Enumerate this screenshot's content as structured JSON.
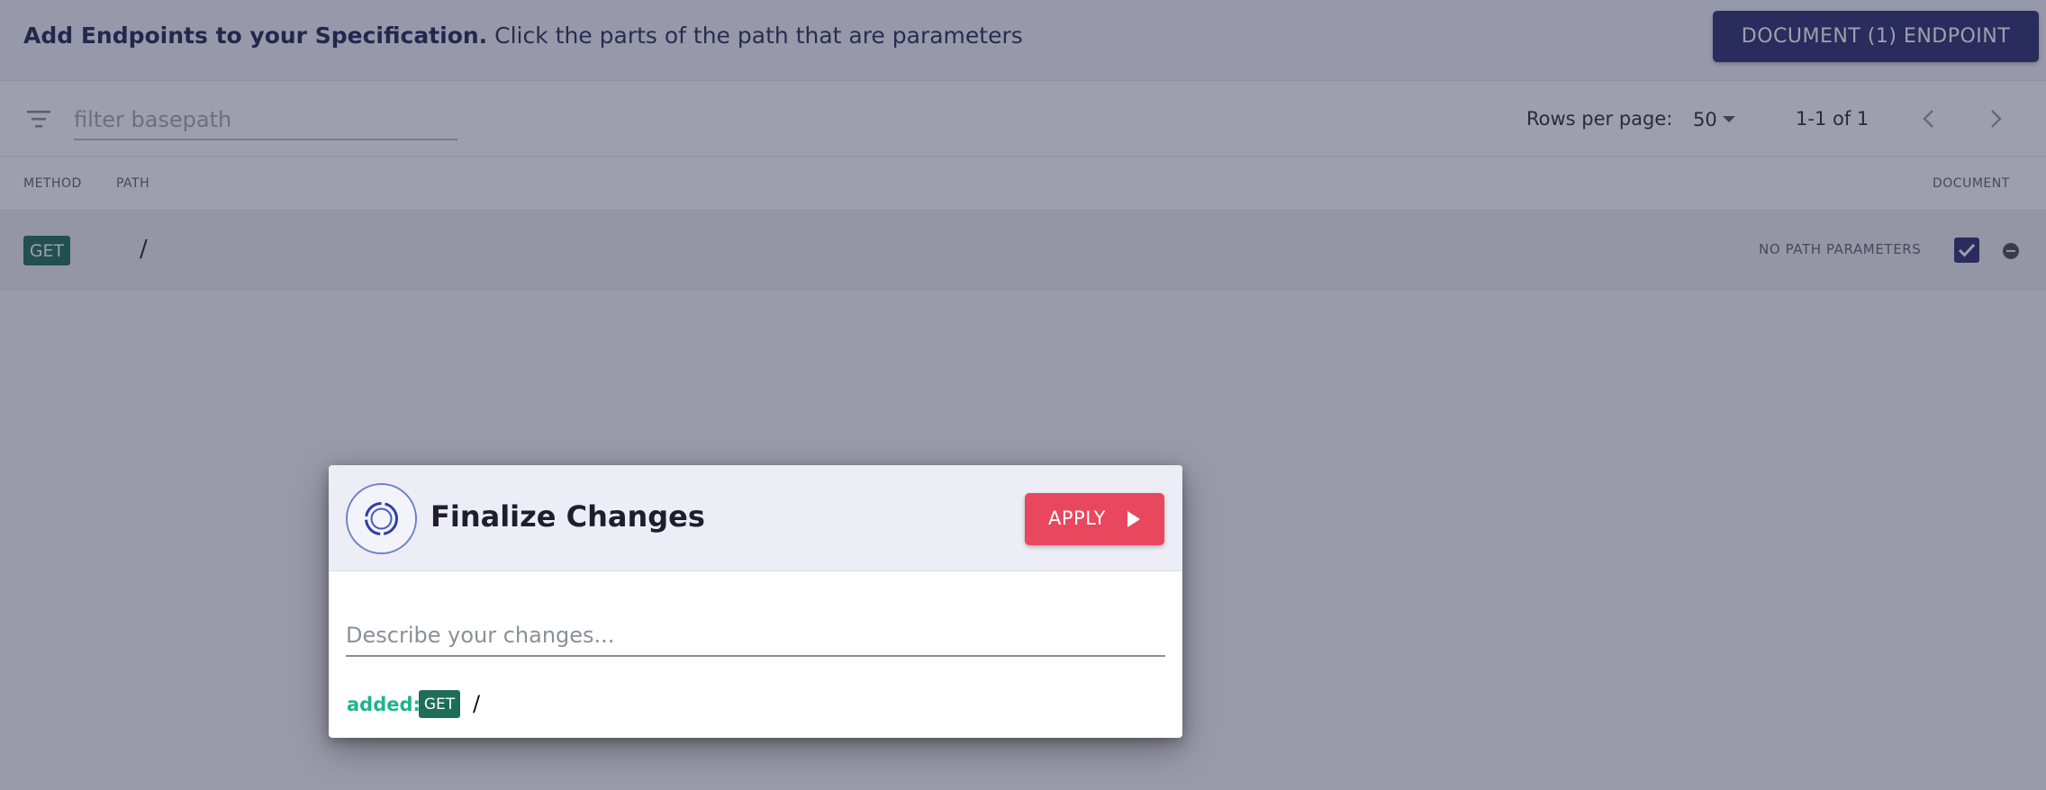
{
  "header": {
    "title_strong": "Add Endpoints to your Specification.",
    "title_rest": " Click the parts of the path that are parameters",
    "document_button_label": "DOCUMENT (1) ENDPOINT"
  },
  "toolbar": {
    "filter_icon": "filter-list-icon",
    "filter_placeholder": "filter basepath",
    "rows_per_page_label": "Rows per page:",
    "rows_per_page_value": "50",
    "page_info": "1-1 of 1",
    "prev_icon": "chevron-left-icon",
    "next_icon": "chevron-right-icon"
  },
  "table": {
    "headers": {
      "method": "METHOD",
      "path": "PATH",
      "document": "DOCUMENT"
    },
    "rows": [
      {
        "method": "GET",
        "path": "/",
        "status": "NO PATH PARAMETERS",
        "documented": true
      }
    ]
  },
  "dialog": {
    "title": "Finalize Changes",
    "apply_label": "APPLY",
    "description_placeholder": "Describe your changes...",
    "added_label": "added:",
    "added_method": "GET",
    "added_path": "/"
  },
  "colors": {
    "primary": "#2d2f70",
    "accent": "#e8475e",
    "method_get": "#1e6e56",
    "added_text": "#1fb48c"
  }
}
